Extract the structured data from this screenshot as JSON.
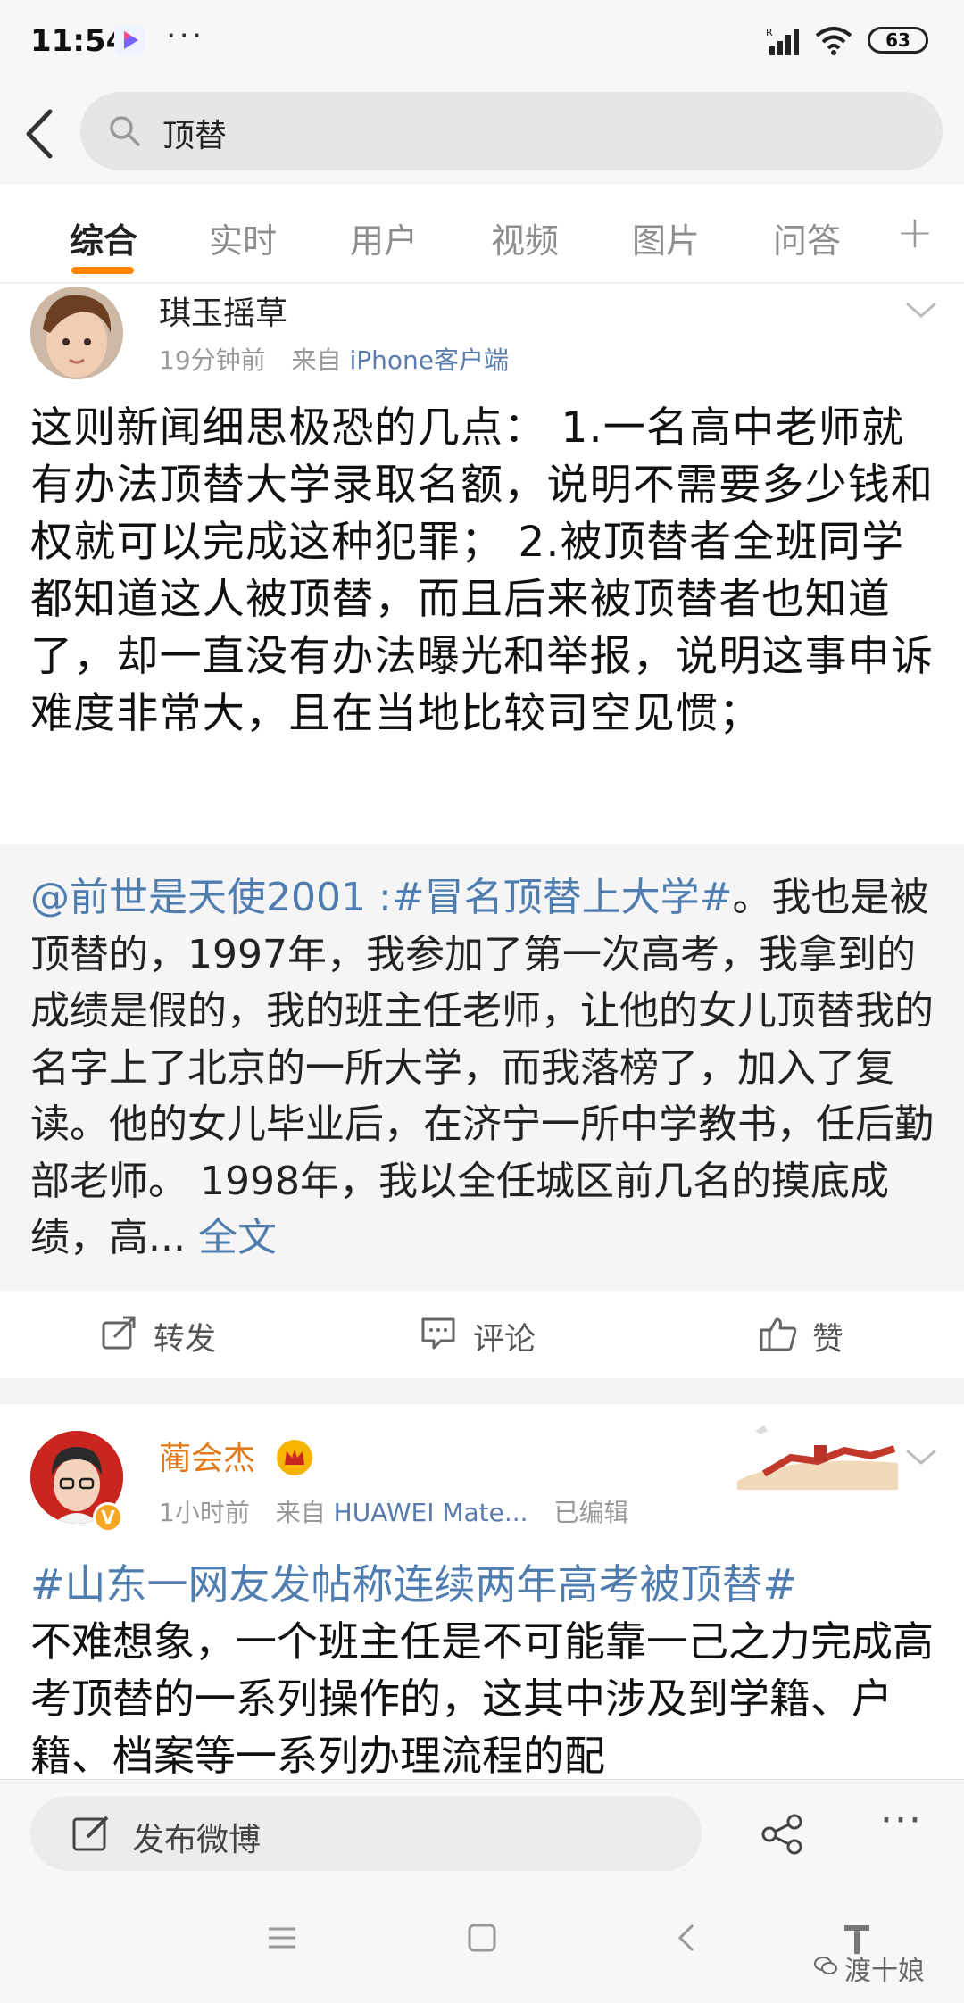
{
  "status_bar": {
    "time": "11:54",
    "dots": "···",
    "battery": "63"
  },
  "search": {
    "query": "顶替"
  },
  "tabs": {
    "items": [
      {
        "label": "综合",
        "active": true
      },
      {
        "label": "实时"
      },
      {
        "label": "用户"
      },
      {
        "label": "视频"
      },
      {
        "label": "图片"
      },
      {
        "label": "问答"
      }
    ],
    "plus": "+"
  },
  "post1": {
    "author": "琪玉摇草",
    "time_ago": "19分钟前",
    "source_prefix": "来自",
    "source": "iPhone客户端",
    "text": "这则新闻细思极恐的几点：        1.一名高中老师就有办法顶替大学录取名额，说明不需要多少钱和权就可以完成这种犯罪；        2.被顶替者全班同学都知道这人被顶替，而且后来被顶替者也知道了，却一直没有办法曝光和举报，说明这事申诉难度非常大，且在当地比较司空见惯；",
    "retweet": {
      "mention": "@前世是天使2001",
      "colon": " :",
      "hashtag": "#冒名顶替上大学#",
      "text": "。我也是被顶替的，1997年，我参加了第一次高考，我拿到的成绩是假的，我的班主任老师，让他的女儿顶替我的名字上了北京的一所大学，而我落榜了，加入了复读。他的女儿毕业后，在济宁一所中学教书，任后勤部老师。 1998年，我以全任城区前几名的摸底成绩，高...",
      "more": " 全文"
    },
    "actions": {
      "repost": "转发",
      "comment": "评论",
      "like": "赞"
    }
  },
  "post2": {
    "author": "蔺会杰",
    "time_ago": "1小时前",
    "source_prefix": "来自",
    "source": "HUAWEI Mate...",
    "edited": "已编辑",
    "hashtag": "#山东一网友发帖称连续两年高考被顶替#",
    "text": "不难想象，一个班主任是不可能靠一己之力完成高考顶替的一系列操作的，这其中涉及到学籍、户籍、档案等一系列办理流程的配"
  },
  "compose": {
    "label": "发布微博"
  },
  "watermark": "渡十娘",
  "colors": {
    "accent": "#ff8200",
    "link": "#507daf",
    "author2": "#e0781a"
  }
}
